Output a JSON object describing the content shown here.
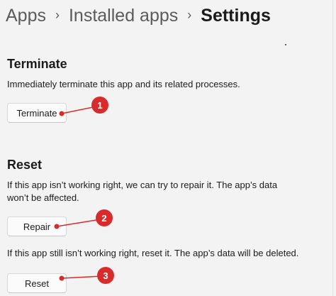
{
  "breadcrumb": {
    "item1": "Apps",
    "item2": "Installed apps",
    "current": "Settings",
    "separator": "›"
  },
  "terminate": {
    "title": "Terminate",
    "description": "Immediately terminate this app and its related processes.",
    "button_label": "Terminate"
  },
  "reset": {
    "title": "Reset",
    "repair_description_line1": "If this app isn’t working right, we can try to repair it. The app’s data",
    "repair_description_line2": "won’t be affected.",
    "repair_button_label": "Repair",
    "reset_description": "If this app still isn’t working right, reset it. The app’s data will be deleted.",
    "reset_button_label": "Reset"
  },
  "annotations": {
    "color": "#d92b2b",
    "markers": [
      "1",
      "2",
      "3"
    ]
  }
}
